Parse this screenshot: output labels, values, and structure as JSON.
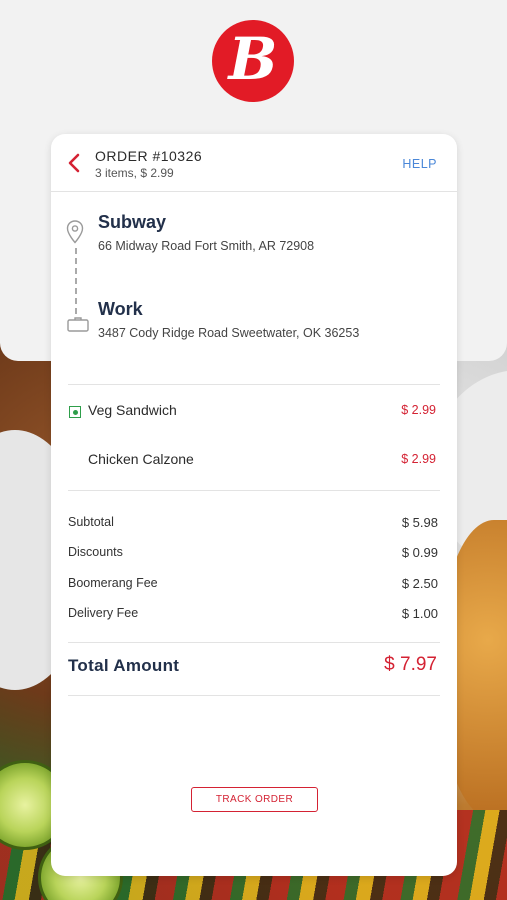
{
  "header": {
    "order_id": "ORDER #10326",
    "order_summary": "3 items, $ 2.99",
    "help_label": "HELP"
  },
  "logo": {
    "letter": "B",
    "color": "#e21b26"
  },
  "route": {
    "pickup": {
      "name": "Subway",
      "address": "66 Midway Road Fort Smith, AR 72908",
      "icon": "location-pin-icon"
    },
    "dropoff": {
      "name": "Work",
      "address": "3487 Cody Ridge Road Sweetwater, OK 36253",
      "icon": "briefcase-icon"
    }
  },
  "items": [
    {
      "name": "Veg Sandwich",
      "price": "$ 2.99",
      "veg": true
    },
    {
      "name": "Chicken Calzone",
      "price": "$ 2.99",
      "veg": false
    }
  ],
  "summary": [
    {
      "label": "Subtotal",
      "value": "$ 5.98"
    },
    {
      "label": "Discounts",
      "value": "$ 0.99"
    },
    {
      "label": "Boomerang Fee",
      "value": "$ 2.50"
    },
    {
      "label": "Delivery Fee",
      "value": "$ 1.00"
    }
  ],
  "total": {
    "label": "Total Amount",
    "value": "$ 7.97"
  },
  "actions": {
    "track_label": "TRACK ORDER"
  },
  "colors": {
    "accent": "#d42233",
    "link": "#4a87d8",
    "veg": "#2e9e4a",
    "heading": "#22304a"
  }
}
